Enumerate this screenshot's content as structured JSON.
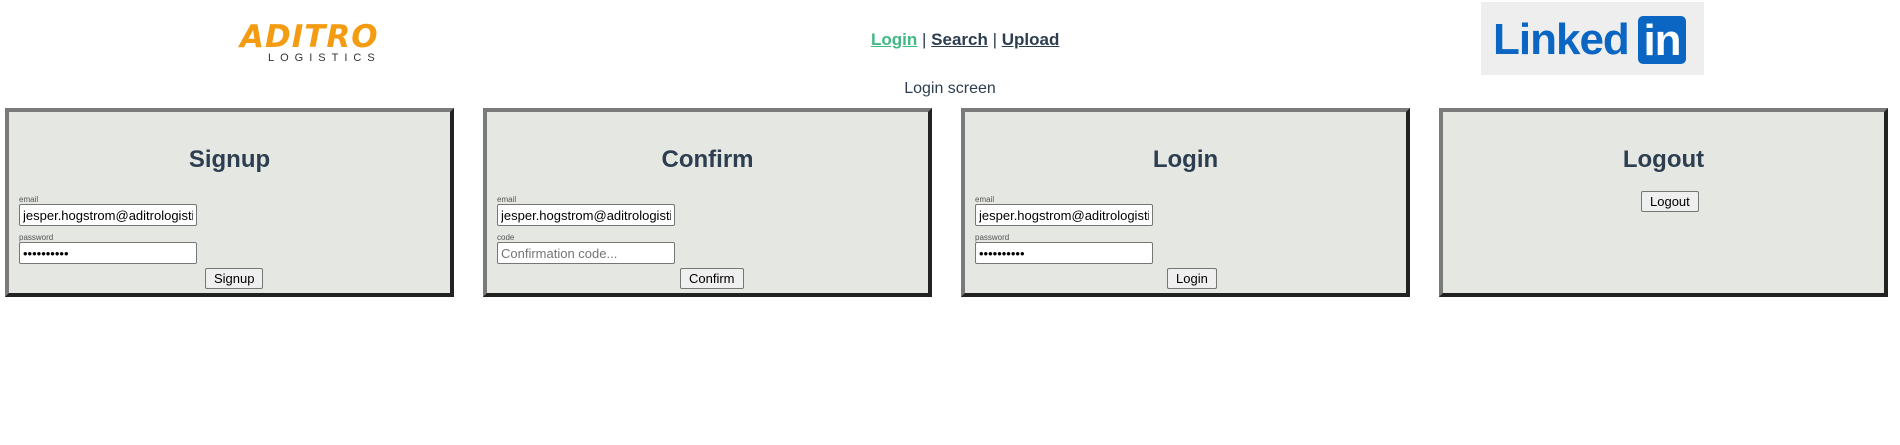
{
  "header": {
    "logo_left": {
      "word": "ADITRO",
      "sub": "LOGISTICS"
    },
    "nav": [
      {
        "label": "Login",
        "active": true
      },
      {
        "label": "Search",
        "active": false
      },
      {
        "label": "Upload",
        "active": false
      }
    ],
    "nav_separator": "|",
    "logo_right": {
      "word": "Linked",
      "box": "in"
    }
  },
  "subtitle": "Login screen",
  "panels": {
    "signup": {
      "title": "Signup",
      "email_label": "email",
      "email_value": "jesper.hogstrom@aditrologistics.com",
      "password_label": "password",
      "password_value": "••••••••••",
      "button": "Signup"
    },
    "confirm": {
      "title": "Confirm",
      "email_label": "email",
      "email_value": "jesper.hogstrom@aditrologistics.com",
      "code_label": "code",
      "code_value": "",
      "code_placeholder": "Confirmation code...",
      "button": "Confirm"
    },
    "login": {
      "title": "Login",
      "email_label": "email",
      "email_value": "jesper.hogstrom@aditrologistics.com",
      "password_label": "password",
      "password_value": "••••••••••",
      "button": "Login"
    },
    "logout": {
      "title": "Logout",
      "button": "Logout"
    }
  },
  "colors": {
    "accent_active_link": "#42b983",
    "text": "#2c3e50",
    "aditro_orange": "#f39c12",
    "linkedin_blue": "#0a66c2",
    "panel_bg": "#e5e7e3"
  }
}
